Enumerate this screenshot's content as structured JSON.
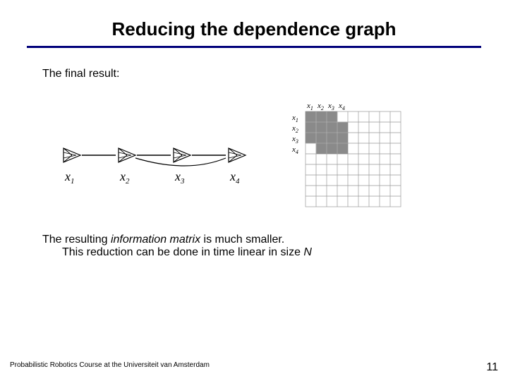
{
  "title": "Reducing the dependence graph",
  "intro": "The final result:",
  "graph": {
    "node_labels": [
      "x",
      "x",
      "x",
      "x"
    ],
    "node_subs": [
      "1",
      "2",
      "3",
      "4"
    ]
  },
  "matrix": {
    "col_labels": [
      "x",
      "x",
      "x",
      "x"
    ],
    "col_subs": [
      "1",
      "2",
      "3",
      "4"
    ],
    "row_labels": [
      "x",
      "x",
      "x",
      "x"
    ],
    "row_subs": [
      "1",
      "2",
      "3",
      "4"
    ]
  },
  "conclusion": {
    "pre": "The resulting ",
    "em": "information matrix",
    "post": " is much smaller.",
    "line2_pre": "This reduction can be done in time linear in size ",
    "line2_em": "N"
  },
  "footer": "Probabilistic Robotics Course at the Universiteit van Amsterdam",
  "page_number": "11"
}
